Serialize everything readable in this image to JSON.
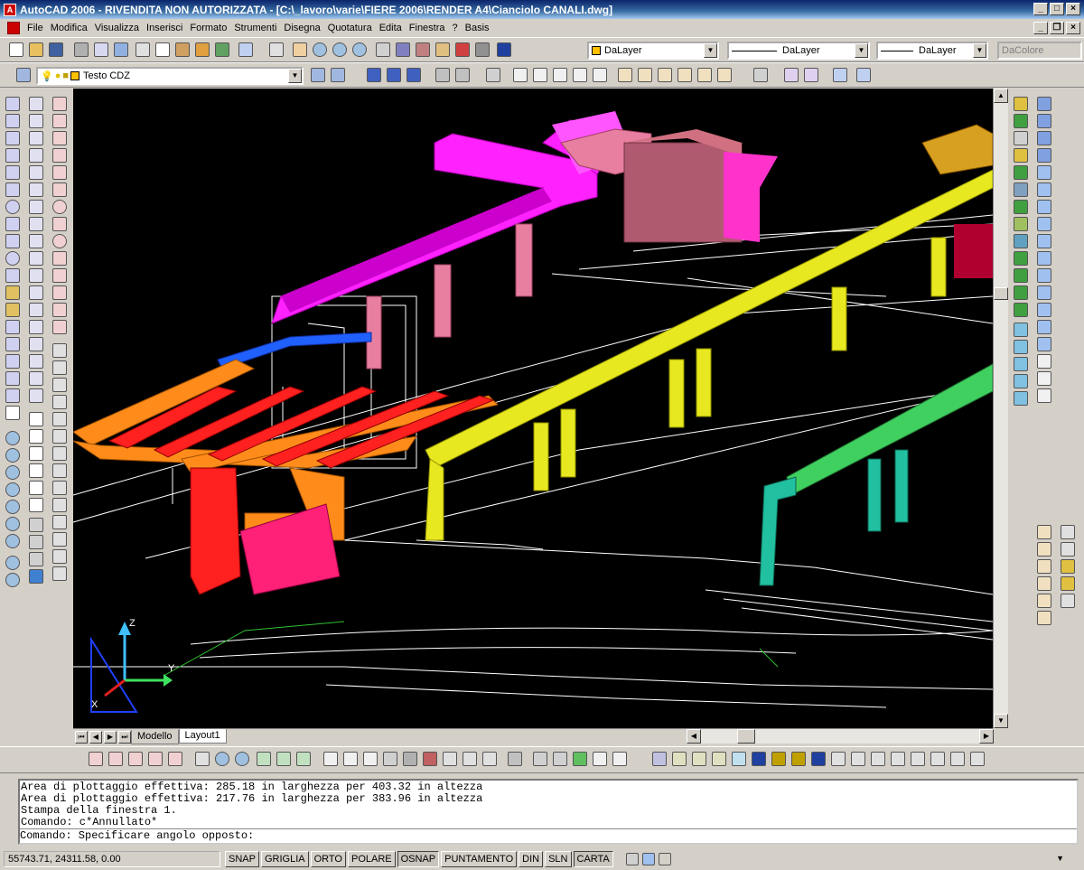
{
  "window": {
    "title": "AutoCAD 2006 - RIVENDITA NON AUTORIZZATA - [C:\\_lavoro\\varie\\FIERE 2006\\RENDER A4\\Cianciolo CANALI.dwg]"
  },
  "menu": [
    "File",
    "Modifica",
    "Visualizza",
    "Inserisci",
    "Formato",
    "Strumenti",
    "Disegna",
    "Quotatura",
    "Edita",
    "Finestra",
    "?",
    "Basis"
  ],
  "properties": {
    "color": "DaLayer",
    "linetype": "DaLayer",
    "lineweight": "DaLayer",
    "plotstyle": "DaColore"
  },
  "layer": {
    "name": "Testo CDZ"
  },
  "layout_tabs": [
    {
      "label": "Modello"
    },
    {
      "label": "Layout1"
    }
  ],
  "ucs": {
    "x": "X",
    "y": "Y",
    "z": "Z"
  },
  "command": {
    "history": [
      "Area di plottaggio effettiva: 285.18 in larghezza per 403.32 in altezza",
      "Area di plottaggio effettiva: 217.76 in larghezza per 383.96 in altezza",
      "Stampa della finestra 1.",
      "Comando: c*Annullato*"
    ],
    "prompt": "Comando: Specificare angolo opposto:"
  },
  "status": {
    "coords": "55743.71, 24311.58, 0.00",
    "toggles": [
      {
        "label": "SNAP",
        "on": false
      },
      {
        "label": "GRIGLIA",
        "on": false
      },
      {
        "label": "ORTO",
        "on": false
      },
      {
        "label": "POLARE",
        "on": false
      },
      {
        "label": "OSNAP",
        "on": true
      },
      {
        "label": "PUNTAMENTO",
        "on": false
      },
      {
        "label": "DIN",
        "on": false
      },
      {
        "label": "SLN",
        "on": false
      },
      {
        "label": "CARTA",
        "on": true
      }
    ]
  },
  "colors": {
    "magenta": "#ff22ff",
    "pink": "#e87fa0",
    "orange": "#ff8c1a",
    "red": "#ff2020",
    "yellow": "#e8e820",
    "gold": "#d8a020",
    "green": "#40d060",
    "teal": "#20c0a0",
    "blue": "#2060ff"
  }
}
